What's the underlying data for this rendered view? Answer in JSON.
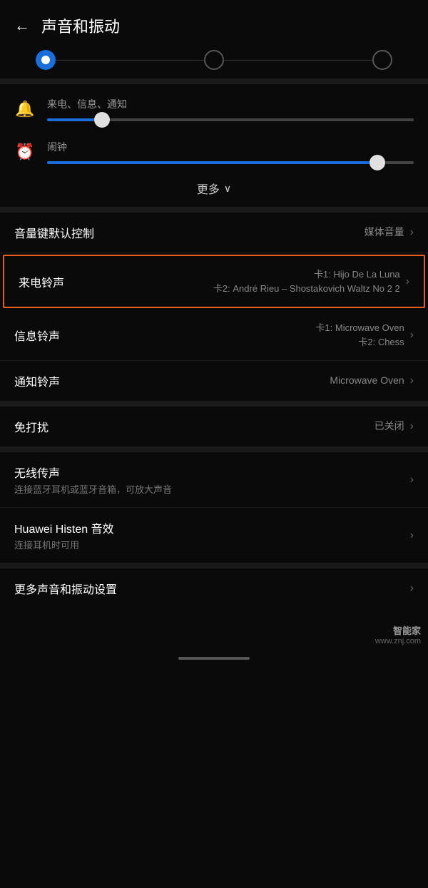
{
  "header": {
    "back_label": "←",
    "title": "声音和振动"
  },
  "tabs": [
    {
      "id": "tab1",
      "active": true
    },
    {
      "id": "tab2",
      "active": false
    },
    {
      "id": "tab3",
      "active": false
    }
  ],
  "sliders": {
    "notification": {
      "label": "来电、信息、通知",
      "value": 15
    },
    "alarm": {
      "label": "闹钟",
      "value": 90
    }
  },
  "more_button": {
    "label": "更多",
    "chevron": "∨"
  },
  "menu_items": [
    {
      "id": "volume-key",
      "label": "音量键默认控制",
      "value": "媒体音量",
      "has_arrow": true,
      "highlighted": false,
      "sub_label": null,
      "value_line2": null
    },
    {
      "id": "ringtone",
      "label": "来电铃声",
      "value_line1": "卡1: Hijo De La Luna",
      "value_line2": "卡2: André Rieu – Shostakovich Waltz No 2 2",
      "has_arrow": true,
      "highlighted": true
    },
    {
      "id": "message-tone",
      "label": "信息铃声",
      "value_line1": "卡1: Microwave Oven",
      "value_line2": "卡2: Chess",
      "has_arrow": true,
      "highlighted": false
    },
    {
      "id": "notification-tone",
      "label": "通知铃声",
      "value_line1": "Microwave Oven",
      "value_line2": null,
      "has_arrow": true,
      "highlighted": false
    }
  ],
  "section2": [
    {
      "id": "do-not-disturb",
      "label": "免打扰",
      "value": "已关闭",
      "has_arrow": true
    }
  ],
  "section3": [
    {
      "id": "wireless-audio",
      "label": "无线传声",
      "sub_label": "连接蓝牙耳机或蓝牙音箱，可放大声音",
      "has_arrow": true
    },
    {
      "id": "huawei-histen",
      "label": "Huawei Histen 音效",
      "sub_label": "连接耳机时可用",
      "has_arrow": true
    }
  ],
  "section4": [
    {
      "id": "more-sound",
      "label": "更多声音和振动设置",
      "has_arrow": true
    }
  ],
  "footer": {
    "logo_main": "智能家",
    "logo_url": "www.znj.com"
  }
}
